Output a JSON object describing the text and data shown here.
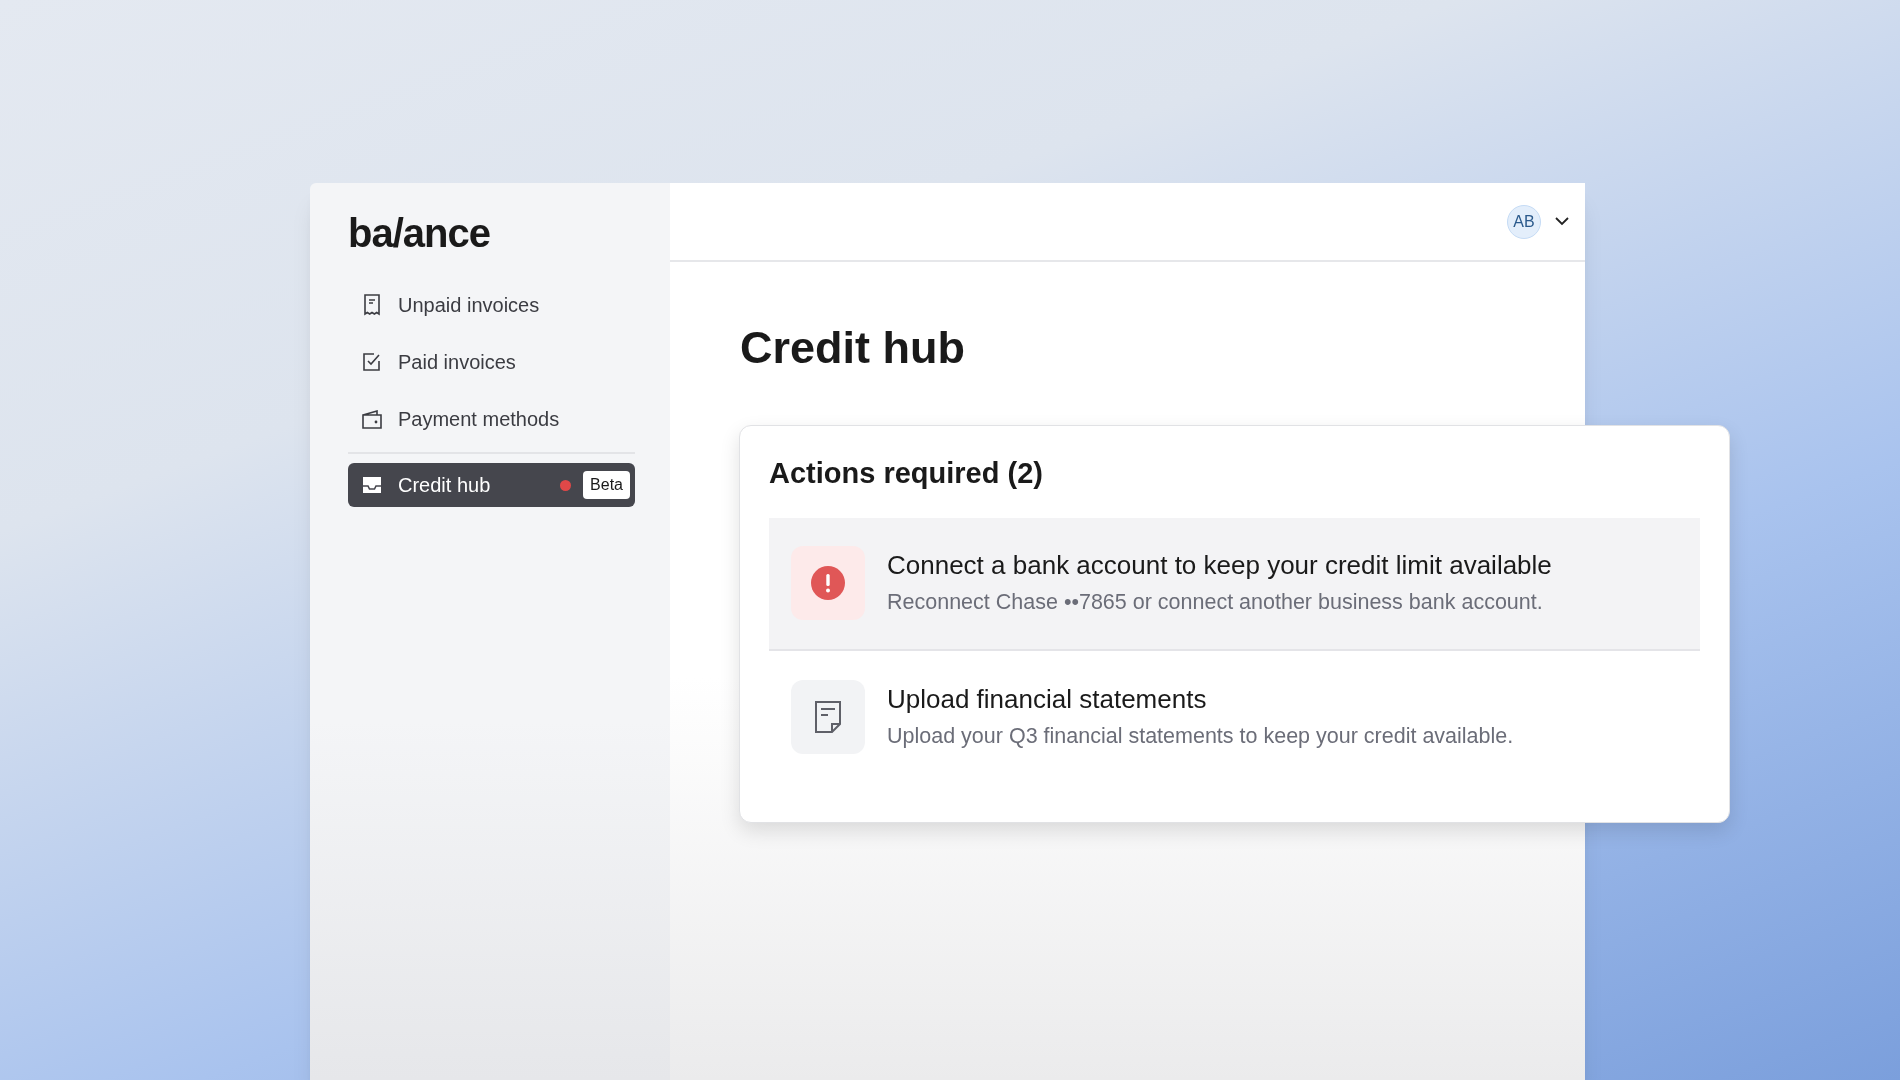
{
  "logo": "ba/ance",
  "nav_groups": [
    [
      {
        "label": "Unpaid invoices",
        "selected": false,
        "alert": false
      },
      {
        "label": "Paid invoices",
        "selected": false,
        "alert": false
      },
      {
        "label": "Payment methods",
        "selected": false,
        "alert": false
      }
    ],
    [
      {
        "label": "Credit hub",
        "selected": true,
        "alert": true,
        "badge": "Beta"
      }
    ]
  ],
  "user": {
    "initials": "AB"
  },
  "page_title": "Credit hub",
  "actions": {
    "title": "Actions required (2)",
    "items": [
      {
        "kind": "alert",
        "title": "Connect a bank account to keep your credit limit available",
        "subtitle": "Reconnect Chase ••7865 or connect another business bank account.",
        "highlighted": true
      },
      {
        "kind": "document",
        "title": "Upload financial statements",
        "subtitle": "Upload your Q3 financial statements to keep your credit available.",
        "highlighted": false
      }
    ]
  }
}
